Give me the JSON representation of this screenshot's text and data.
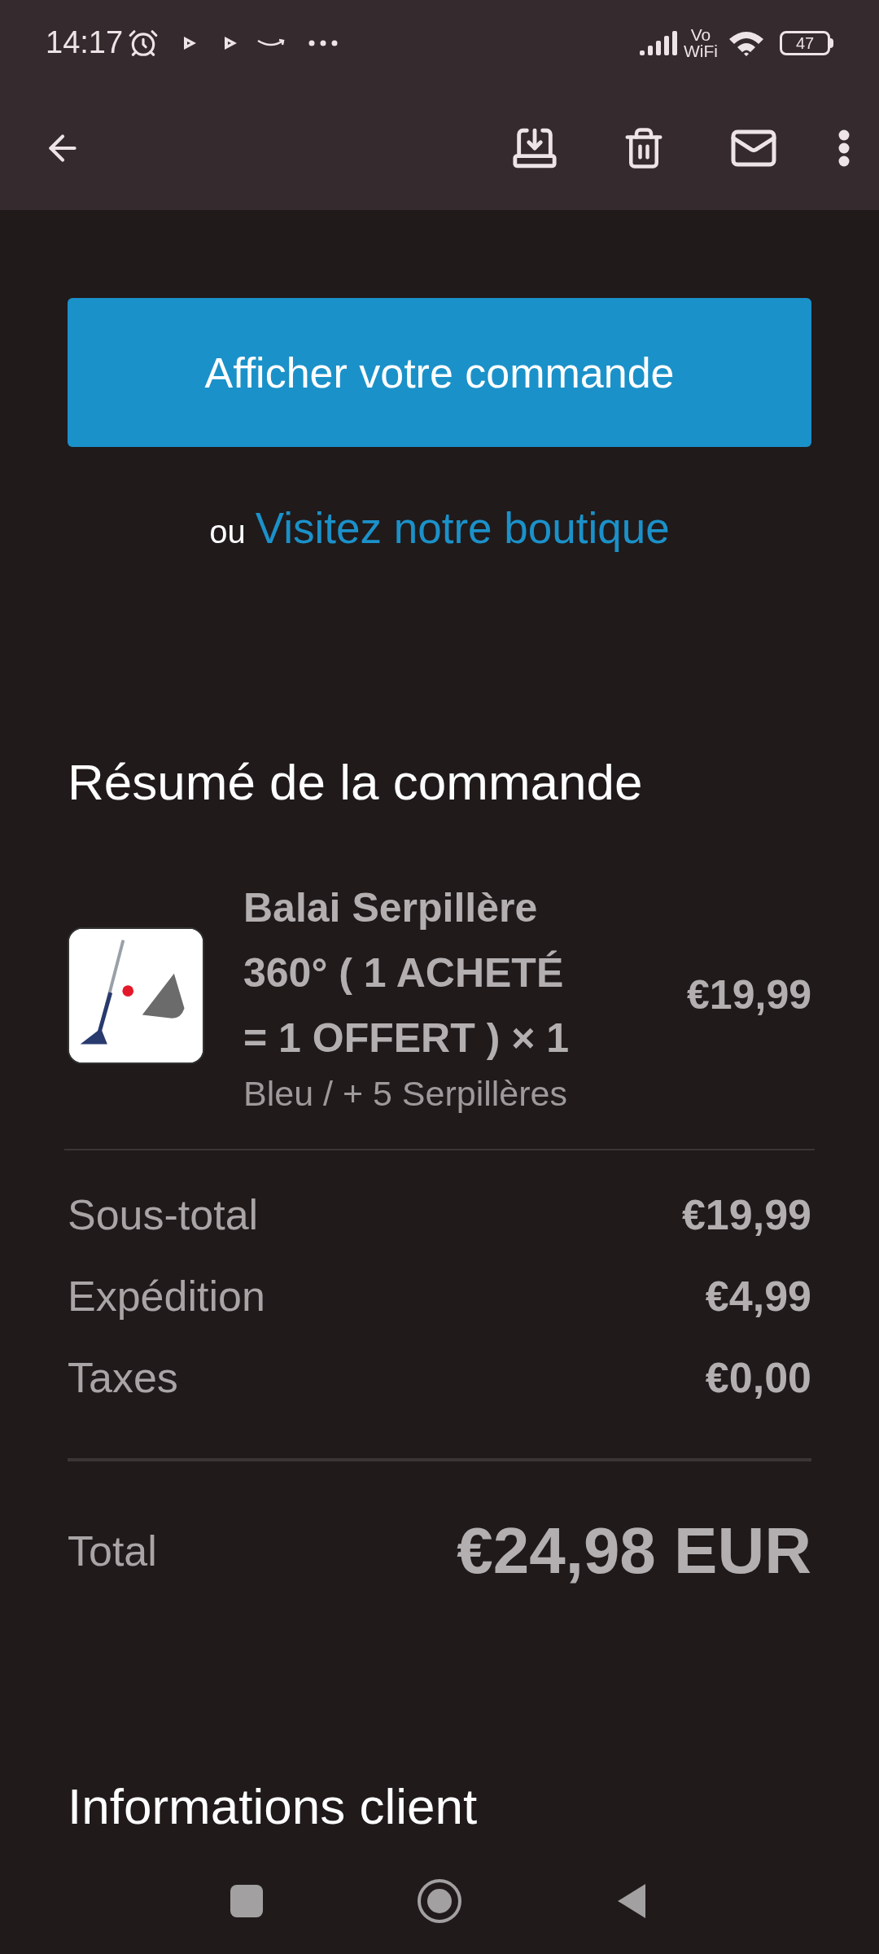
{
  "status_bar": {
    "time": "14:17",
    "network_label": [
      "Vo",
      "WiFi"
    ],
    "battery": "47"
  },
  "email_body": {
    "primary_button": "Afficher votre commande",
    "alt_prefix": "ou",
    "alt_link": "Visitez notre boutique",
    "summary_title": "Résumé de la commande",
    "items": [
      {
        "title": "Balai Serpillère 360° ( 1 ACHETÉ = 1 OFFERT ) × 1",
        "variant": "Bleu / + 5 Serpillères",
        "price": "€19,99"
      }
    ],
    "totals": [
      {
        "label": "Sous-total",
        "value": "€19,99"
      },
      {
        "label": "Expédition",
        "value": "€4,99"
      },
      {
        "label": "Taxes",
        "value": "€0,00"
      }
    ],
    "total": {
      "label": "Total",
      "value": "€24,98 EUR"
    },
    "next_section_title": "Informations client"
  }
}
